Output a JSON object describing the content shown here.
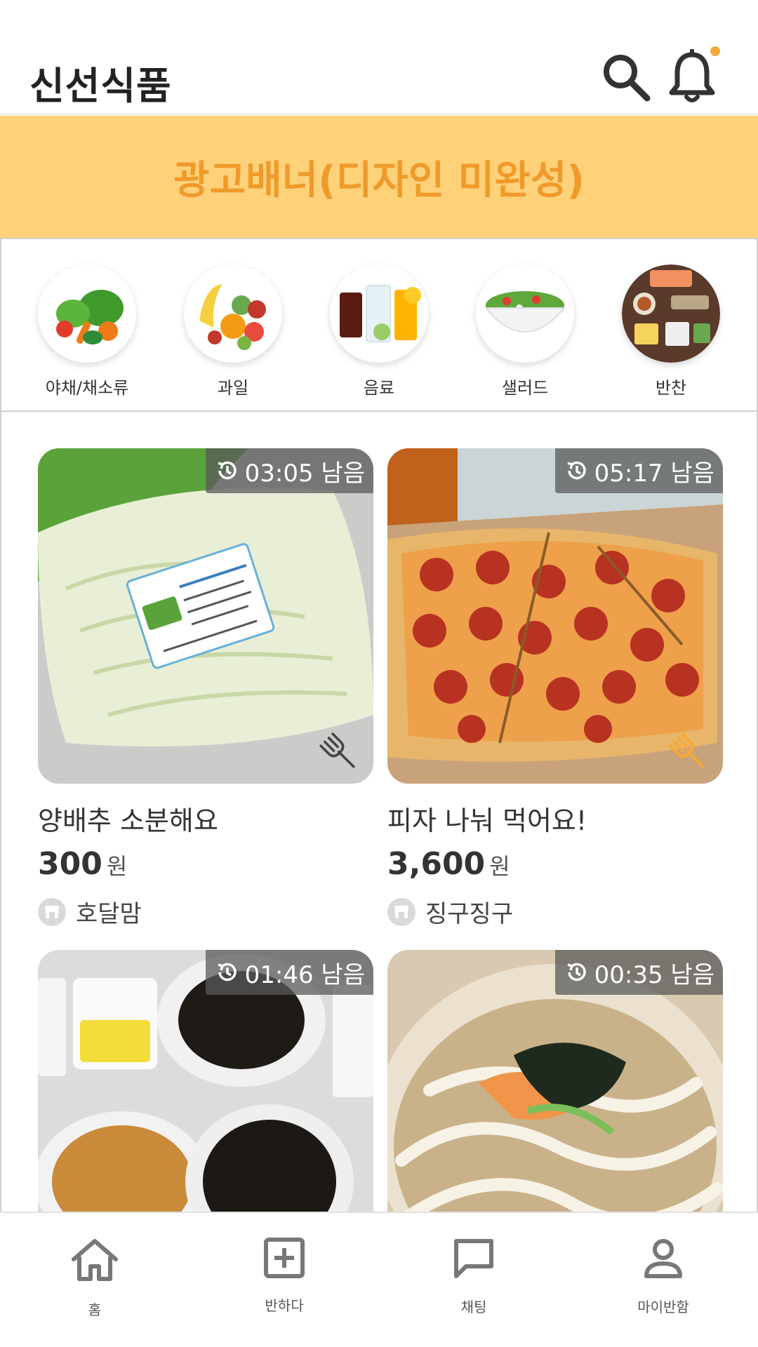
{
  "header": {
    "title": "신선식품"
  },
  "banner": {
    "text": "광고배너(디자인 미완성)"
  },
  "categories": [
    {
      "label": "야채/채소류",
      "icon": "vegetables-icon"
    },
    {
      "label": "과일",
      "icon": "fruits-icon"
    },
    {
      "label": "음료",
      "icon": "drinks-icon"
    },
    {
      "label": "샐러드",
      "icon": "salad-icon"
    },
    {
      "label": "반찬",
      "icon": "side-dishes-icon"
    }
  ],
  "products": [
    {
      "timer": "03:05 남음",
      "title": "양배추 소분해요",
      "price": "300",
      "currency": "원",
      "seller": "호달맘",
      "fork_color": "#444444"
    },
    {
      "timer": "05:17 남음",
      "title": "피자 나눠 먹어요!",
      "price": "3,600",
      "currency": "원",
      "seller": "징구징구",
      "fork_color": "#f6a93a"
    },
    {
      "timer": "01:46 남음",
      "title": "",
      "price": "",
      "currency": "",
      "seller": ""
    },
    {
      "timer": "00:35 남음",
      "title": "",
      "price": "",
      "currency": "",
      "seller": ""
    }
  ],
  "nav": [
    {
      "label": "홈",
      "icon": "home-icon"
    },
    {
      "label": "반하다",
      "icon": "add-square-icon"
    },
    {
      "label": "채팅",
      "icon": "chat-icon"
    },
    {
      "label": "마이반함",
      "icon": "person-icon"
    }
  ],
  "colors": {
    "accent": "#f6a93a",
    "banner_bg": "#ffd27a",
    "banner_text": "#f09a2a"
  }
}
